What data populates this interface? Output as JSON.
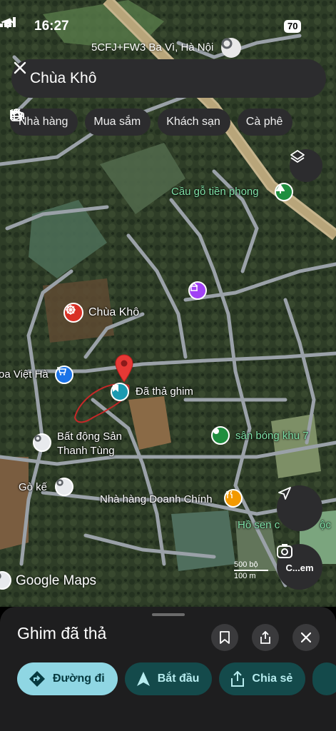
{
  "status_bar": {
    "time": "16:27",
    "battery": "70"
  },
  "plus_code": "5CFJ+FW3 Ba Vì, Hà Nội",
  "search": {
    "query": "Chùa Khô"
  },
  "categories": [
    {
      "label": "Nhà hàng",
      "icon": "fork-knife-icon"
    },
    {
      "label": "Mua sắm",
      "icon": "shopping-bag-icon"
    },
    {
      "label": "Khách sạn",
      "icon": "bed-icon"
    },
    {
      "label": "Cà phê",
      "icon": "coffee-icon"
    }
  ],
  "map_labels": {
    "bridge": "Cầu gỗ tiền phong",
    "temple": "Chùa Khô",
    "shop": "oa Việt Hà",
    "dropped_pin": "Đã thả ghim",
    "field": "sân bóng khu 7",
    "realestate_line1": "Bất động Sản",
    "realestate_line2": "Thanh Tùng",
    "go_ke": "Gò kế",
    "restaurant": "Nhà hàng Doanh Chính",
    "lotus_pond": "Hồ sen c",
    "lotus_pond_tail": "ộc"
  },
  "scale": {
    "ft": "500 bộ",
    "m": "100 m"
  },
  "lens_label": "C...em",
  "watermark": "Google Maps",
  "sheet": {
    "title": "Ghim đã thả",
    "actions": [
      {
        "label": "Đường đi",
        "icon": "directions-icon"
      },
      {
        "label": "Bắt đầu",
        "icon": "navigation-icon"
      },
      {
        "label": "Chia sẻ",
        "icon": "share-icon"
      }
    ]
  },
  "colors": {
    "accent": "#8fd6e3",
    "action_bg": "#144a4b",
    "pin_red": "#e53935",
    "poi_green": "#1e8e3e",
    "poi_blue": "#1a73e8",
    "poi_orange": "#f29900"
  }
}
